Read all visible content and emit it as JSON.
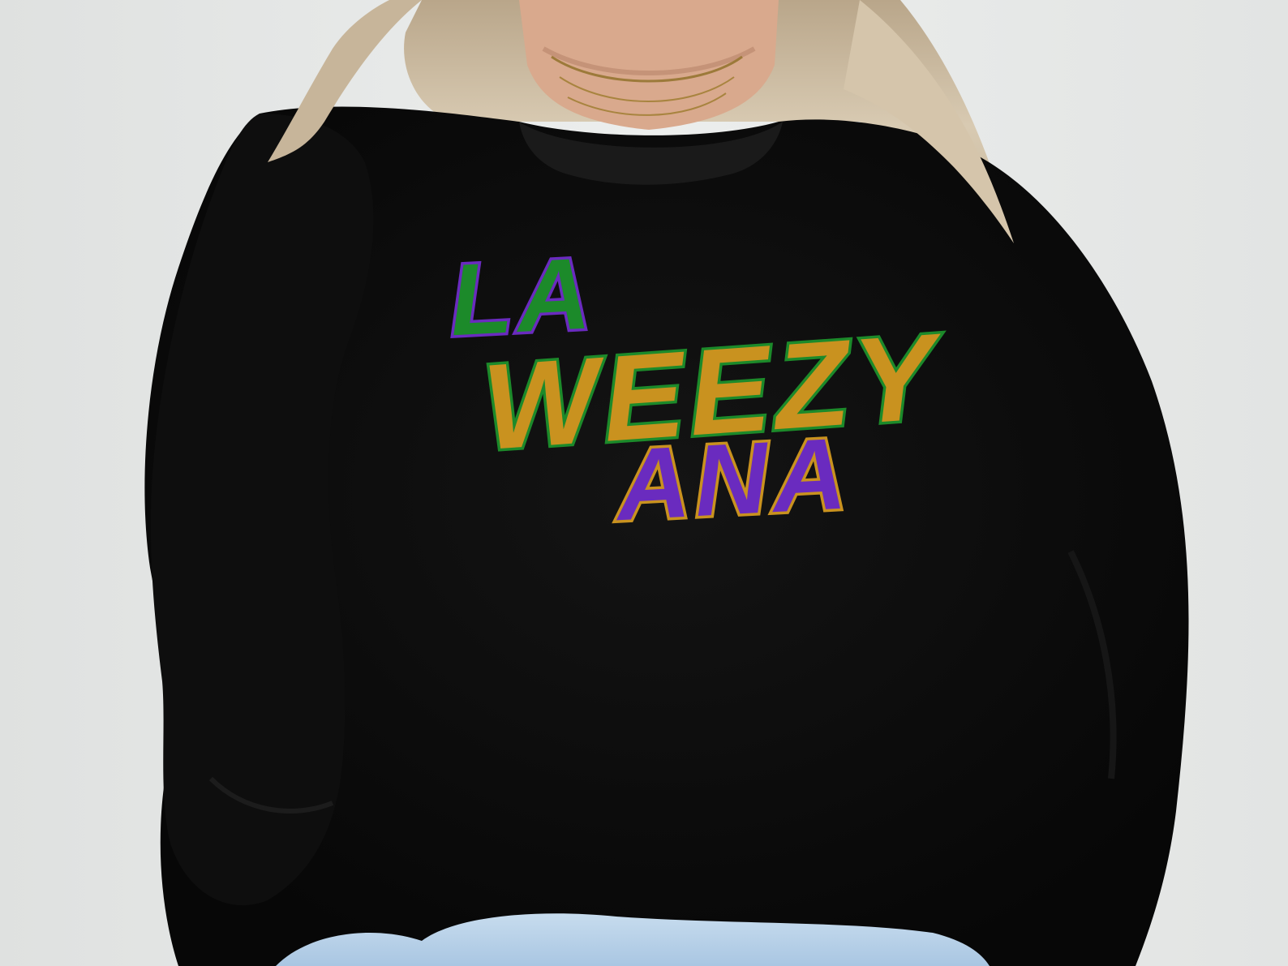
{
  "design": {
    "line1": "LA",
    "line2": "WEEZY",
    "line3": "ANA"
  },
  "colors": {
    "background": "#e4e6e5",
    "sweatshirt": "#0c0c0c",
    "hair": "#c9b9a0",
    "skin": "#d9a98d",
    "jeans": "#b9d3ea",
    "sequin_green": "#1c8a2a",
    "sequin_gold": "#c9921f",
    "sequin_purple": "#6a2bbf"
  }
}
